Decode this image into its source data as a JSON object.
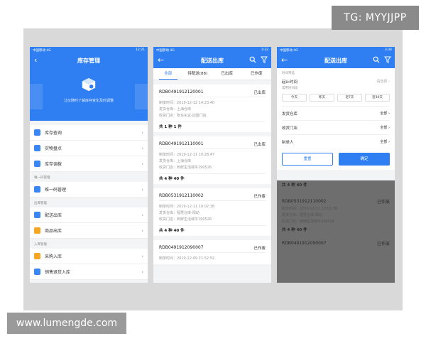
{
  "watermarks": {
    "top_right": "TG: MYYJJPP",
    "bottom_left": "www.lumengde.com"
  },
  "phone1": {
    "status_left": "中国移动 4G",
    "status_right": "12:21",
    "title": "库存管理",
    "hero_text": "让仪随时了解库存变化及时调整",
    "items_top": [
      "库存查询",
      "实物盘点",
      "库存调拨"
    ],
    "section1": "唯一码管理",
    "items_mid": [
      "唯一码管理"
    ],
    "section2": "出库管理",
    "items_out": [
      "配送出库",
      "商品出库"
    ],
    "section3": "入库管理",
    "items_in": [
      "采购入库",
      "销售退货入库"
    ]
  },
  "phone2": {
    "status_left": "中国移动 4G",
    "status_right": "3:32",
    "title": "配送出库",
    "tabs": [
      "全部",
      "待配送(88)",
      "已出库",
      "已作废"
    ],
    "orders": [
      {
        "id": "RDB0491912120001",
        "status": "已出库",
        "time": "制单时间：2019-12-12 14:23:40",
        "warehouse": "发货仓库：上海仓库",
        "store": "收货门店：张东东试-加盟门店",
        "summary": "共 1 种 1 件"
      },
      {
        "id": "RDB0491912110001",
        "status": "已出库",
        "time": "制单时间：2019-12-11 10:28:47",
        "warehouse": "发货仓库：上海仓库",
        "store": "收货门店：刺鲜生活城平190526",
        "summary": "共 4 种 40 件"
      },
      {
        "id": "RDB0531912110002",
        "status": "已作废",
        "time": "制单时间：2019-12-11 10:02:38",
        "warehouse": "发货仓库：程慧仓库-阳动",
        "store": "收货门店：刺鲜生活城平190526",
        "summary": "共 4 种 40 件"
      },
      {
        "id": "RDB0491912090007",
        "status": "已作废",
        "time": "制单时间：2019-12-09 21:52:52",
        "warehouse": "",
        "store": "",
        "summary": ""
      }
    ]
  },
  "phone3": {
    "status_left": "中国移动 4G",
    "status_right": "3:34",
    "title": "配送出库",
    "section_label": "时间筛选",
    "start_time_label": "起止时间",
    "start_time_value": "请选择",
    "quick_label": "常用时间段",
    "chips": [
      "今天",
      "昨天",
      "近7天",
      "近30天"
    ],
    "filters": [
      {
        "label": "发货仓库",
        "value": "全部"
      },
      {
        "label": "收货门店",
        "value": "全部"
      },
      {
        "label": "制单人",
        "value": "全部"
      }
    ],
    "reset_label": "重置",
    "confirm_label": "确定",
    "dim_summary": "共 4 种 40 件",
    "dim_order_id": "RDB0531912110002",
    "dim_order_status": "已作废",
    "dim_lines": [
      "制单时间：2019-12-11 10:02:38",
      "发货仓库：程慧仓库-阳动",
      "收货门店：刺鲜生活城平190526"
    ],
    "dim_summary2": "共 4 种 40 件",
    "dim_order_id2": "RDB0491912090007",
    "dim_order_status2": "已作废"
  },
  "colors": {
    "accent": "#2f7ff2",
    "panel": "#d9d9d9",
    "overlay": "#6e6e6e"
  }
}
